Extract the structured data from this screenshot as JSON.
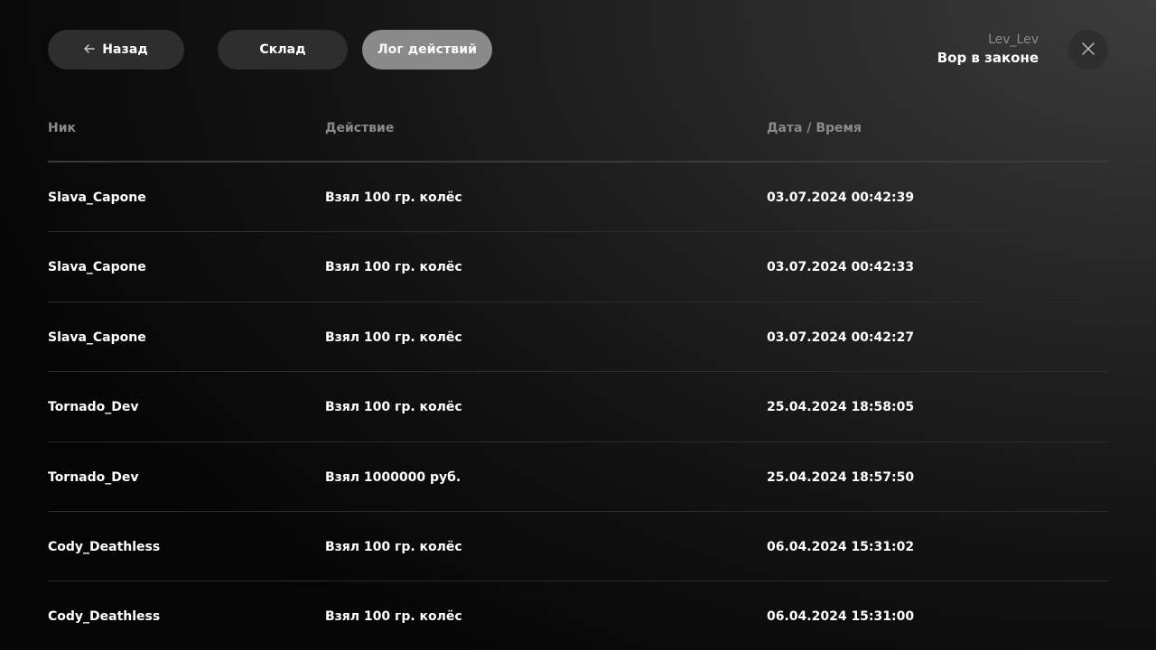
{
  "nav": {
    "back_label": "Назад",
    "stock_label": "Склад",
    "log_label": "Лог действий"
  },
  "user": {
    "nick": "Lev_Lev",
    "rank": "Вор в законе"
  },
  "icons": {
    "back": "arrow-left-icon",
    "close": "close-icon"
  },
  "colors": {
    "active_tab": "#8a8a8a",
    "button_bg": "#2e2e2e",
    "header_text": "#8a8a8a"
  },
  "table": {
    "columns": [
      "Ник",
      "Действие",
      "Дата / Время"
    ],
    "rows": [
      {
        "nick": "Slava_Capone",
        "action": "Взял 100 гр. колёс",
        "datetime": "03.07.2024 00:42:39"
      },
      {
        "nick": "Slava_Capone",
        "action": "Взял 100 гр. колёс",
        "datetime": "03.07.2024 00:42:33"
      },
      {
        "nick": "Slava_Capone",
        "action": "Взял 100 гр. колёс",
        "datetime": "03.07.2024 00:42:27"
      },
      {
        "nick": "Tornado_Dev",
        "action": "Взял 100 гр. колёс",
        "datetime": "25.04.2024 18:58:05"
      },
      {
        "nick": "Tornado_Dev",
        "action": "Взял 1000000 руб.",
        "datetime": "25.04.2024 18:57:50"
      },
      {
        "nick": "Cody_Deathless",
        "action": "Взял 100 гр. колёс",
        "datetime": "06.04.2024 15:31:02"
      },
      {
        "nick": "Cody_Deathless",
        "action": "Взял 100 гр. колёс",
        "datetime": "06.04.2024 15:31:00"
      }
    ]
  }
}
